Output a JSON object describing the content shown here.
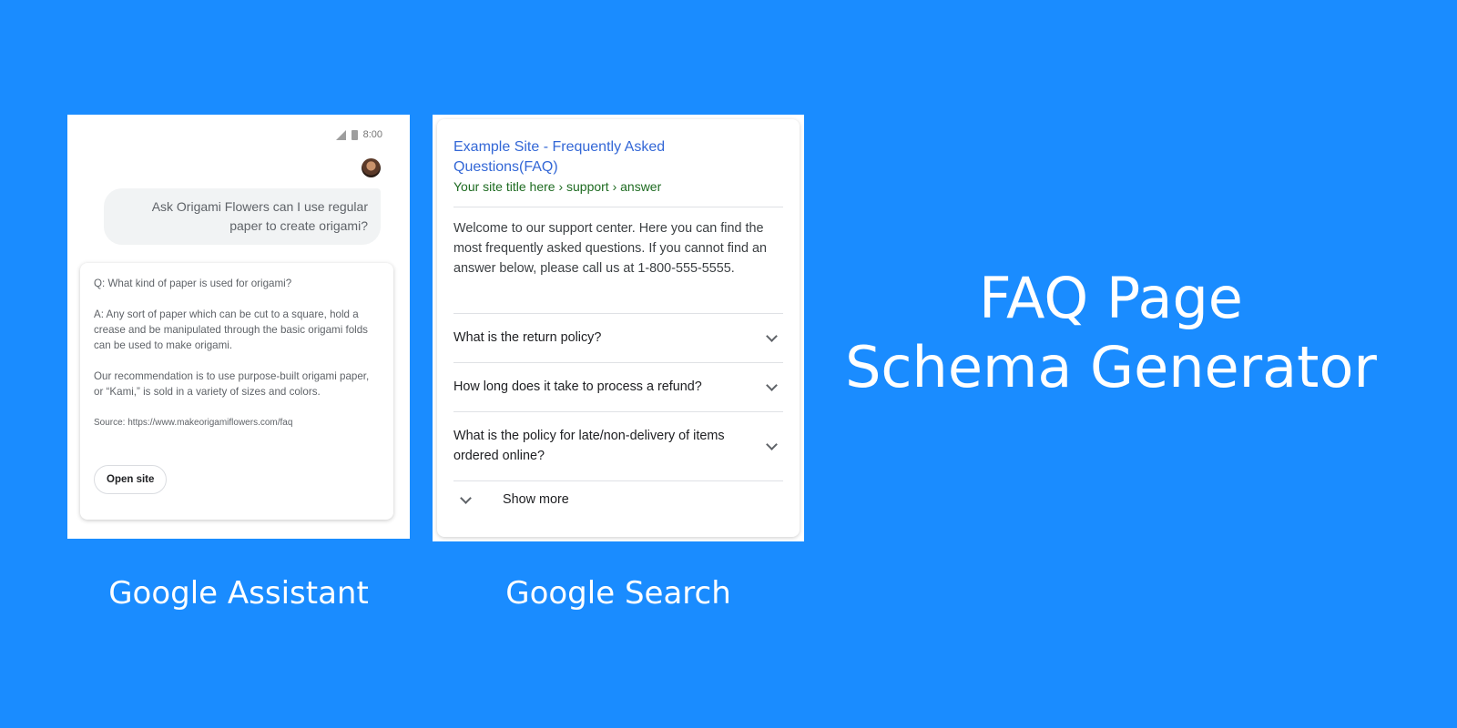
{
  "assistant": {
    "status_time": "8:00",
    "query": "Ask Origami Flowers can I use regular paper to create origami?",
    "question": "Q: What kind of paper is used for origami?",
    "answer": "A: Any sort of paper which can be cut to a square, hold a crease and be manipulated through the basic origami folds can be used to make origami.",
    "recommendation": "Our recommendation is to use purpose-built origami paper, or “Kami,” is sold in a variety of sizes and colors.",
    "source": "Source: https://www.makeorigamiflowers.com/faq",
    "open_site_label": "Open site"
  },
  "search": {
    "title": "Example Site - Frequently Asked Questions(FAQ)",
    "breadcrumb": "Your site title here › support › answer",
    "snippet": "Welcome to our support center. Here you can find the most frequently asked questions. If you cannot find an answer below, please call us at 1-800-555-5555.",
    "faqs": [
      "What is the return policy?",
      "How long does it take to process a refund?",
      "What is the policy for late/non-delivery of items ordered online?"
    ],
    "show_more_label": "Show more"
  },
  "captions": {
    "assistant": "Google Assistant",
    "search": "Google Search"
  },
  "headline": {
    "line1": "FAQ Page",
    "line2": "Schema Generator"
  },
  "colors": {
    "background": "#1a8cff",
    "link_title": "#3367d6",
    "breadcrumb": "#1e6b21"
  }
}
